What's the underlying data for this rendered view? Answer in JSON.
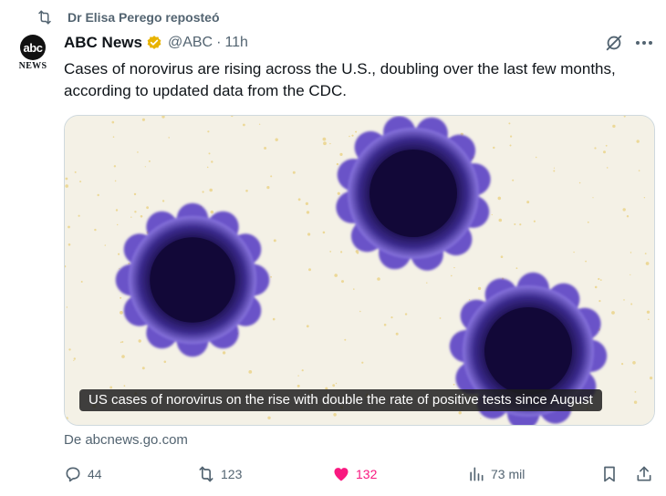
{
  "repost": {
    "label": "Dr Elisa Perego reposteó",
    "icon": "repost-icon"
  },
  "author": {
    "avatar_text": "abc",
    "avatar_subtext": "NEWS",
    "name": "ABC News",
    "verified_color": "#e8b300",
    "handle": "@ABC",
    "separator": "·",
    "time": "11h"
  },
  "tweet": {
    "text": "Cases of norovirus are rising across the U.S., doubling over the last few months, according to updated data from the CDC."
  },
  "media": {
    "caption": "US cases of norovirus on the rise with double the rate of positive tests since August",
    "source": "De abcnews.go.com"
  },
  "actions": {
    "replies": "44",
    "reposts": "123",
    "likes": "132",
    "views": "73 mil",
    "like_color": "#f91880"
  },
  "colors": {
    "text": "#0f1419",
    "muted": "#536471",
    "virus_core": "#150a3a",
    "virus_edge": "#6a52c8"
  }
}
